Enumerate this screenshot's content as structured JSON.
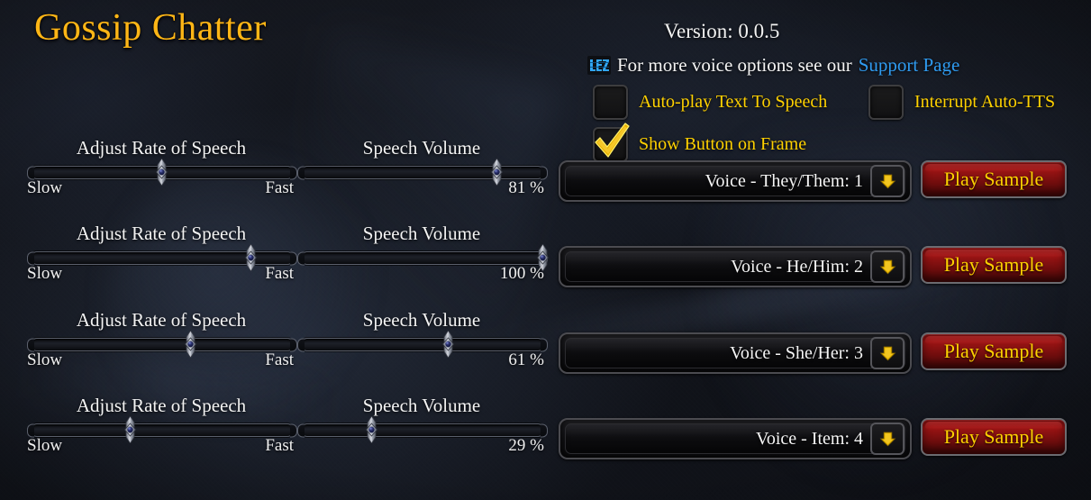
{
  "app": {
    "title": "Gossip Chatter",
    "version_label": "Version: 0.0.5",
    "title_color": "#ffb616"
  },
  "support": {
    "icon": "blizzard-icon",
    "text": "For more voice options see our",
    "link_label": "Support Page",
    "link_color": "#2f9bf0"
  },
  "checkboxes": [
    {
      "name": "auto-play-tts",
      "label": "Auto-play Text To Speech",
      "checked": false
    },
    {
      "name": "interrupt-auto-tts",
      "label": "Interrupt Auto-TTS",
      "checked": false
    },
    {
      "name": "show-button-on-frame",
      "label": "Show Button on Frame",
      "checked": true
    }
  ],
  "labels": {
    "rate_title": "Adjust Rate of Speech",
    "rate_min": "Slow",
    "rate_max": "Fast",
    "volume_title": "Speech Volume",
    "play_sample": "Play Sample",
    "dropdown_arrow_icon": "chevron-down-icon"
  },
  "rows": [
    {
      "rate_title": "Adjust Rate of Speech",
      "rate_min": "Slow",
      "rate_max": "Fast",
      "rate_percent": 50,
      "volume_title": "Speech Volume",
      "volume_value": "81 %",
      "volume_percent": 81,
      "voice_label": "Voice - They/Them: 1",
      "play_label": "Play Sample"
    },
    {
      "rate_title": "Adjust Rate of Speech",
      "rate_min": "Slow",
      "rate_max": "Fast",
      "rate_percent": 84,
      "volume_title": "Speech Volume",
      "volume_value": "100 %",
      "volume_percent": 100,
      "voice_label": "Voice - He/Him: 2",
      "play_label": "Play Sample"
    },
    {
      "rate_title": "Adjust Rate of Speech",
      "rate_min": "Slow",
      "rate_max": "Fast",
      "rate_percent": 61,
      "volume_title": "Speech Volume",
      "volume_value": "61 %",
      "volume_percent": 61,
      "voice_label": "Voice - She/Her: 3",
      "play_label": "Play Sample"
    },
    {
      "rate_title": "Adjust Rate of Speech",
      "rate_min": "Slow",
      "rate_max": "Fast",
      "rate_percent": 38,
      "volume_title": "Speech Volume",
      "volume_value": "29 %",
      "volume_percent": 29,
      "voice_label": "Voice - Item: 4",
      "play_label": "Play Sample"
    }
  ],
  "colors": {
    "gold": "#ffd100",
    "title_gold": "#ffb616",
    "link_blue": "#2f9bf0",
    "button_red": "#9c1414",
    "background": "#15181f"
  }
}
